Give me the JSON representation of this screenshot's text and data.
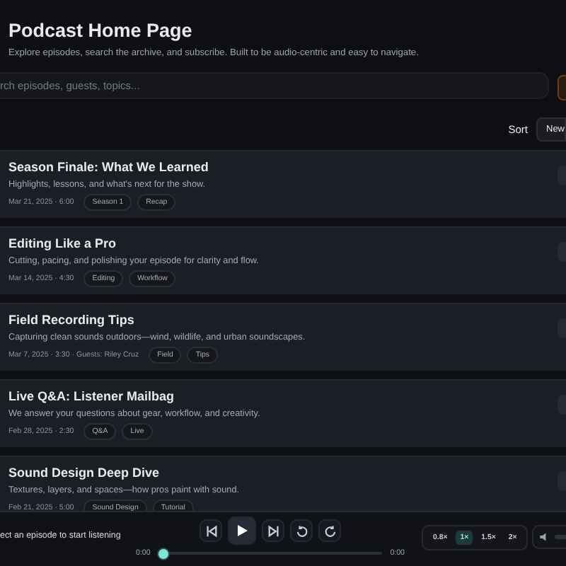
{
  "header": {
    "title": "Podcast Home Page",
    "subtitle": "Explore episodes, search the archive, and subscribe. Built to be audio-centric and easy to navigate."
  },
  "search": {
    "placeholder": "rch episodes, guests, topics..."
  },
  "sort": {
    "label": "Sort",
    "value": "New"
  },
  "episodes": [
    {
      "title": "Season Finale: What We Learned",
      "description": "Highlights, lessons, and what's next for the show.",
      "meta": "Mar 21, 2025 · 6:00",
      "tags": [
        "Season 1",
        "Recap"
      ]
    },
    {
      "title": "Editing Like a Pro",
      "description": "Cutting, pacing, and polishing your episode for clarity and flow.",
      "meta": "Mar 14, 2025 · 4:30",
      "tags": [
        "Editing",
        "Workflow"
      ]
    },
    {
      "title": "Field Recording Tips",
      "description": "Capturing clean sounds outdoors—wind, wildlife, and urban soundscapes.",
      "meta": "Mar 7, 2025 · 3:30 · Guests: Riley Cruz",
      "tags": [
        "Field",
        "Tips"
      ]
    },
    {
      "title": "Live Q&A: Listener Mailbag",
      "description": "We answer your questions about gear, workflow, and creativity.",
      "meta": "Feb 28, 2025 · 2:30",
      "tags": [
        "Q&A",
        "Live"
      ]
    },
    {
      "title": "Sound Design Deep Dive",
      "description": "Textures, layers, and spaces—how pros paint with sound.",
      "meta": "Feb 21, 2025 · 5:00",
      "tags": [
        "Sound Design",
        "Tutorial"
      ]
    }
  ],
  "player": {
    "now_playing": "ect an episode to start listening",
    "elapsed": "0:00",
    "duration": "0:00",
    "progress": {
      "level": 0
    },
    "speeds": [
      {
        "label": "0.8×",
        "selected": false
      },
      {
        "label": "1×",
        "selected": true
      },
      {
        "label": "1.5×",
        "selected": false
      },
      {
        "label": "2×",
        "selected": false
      }
    ]
  }
}
